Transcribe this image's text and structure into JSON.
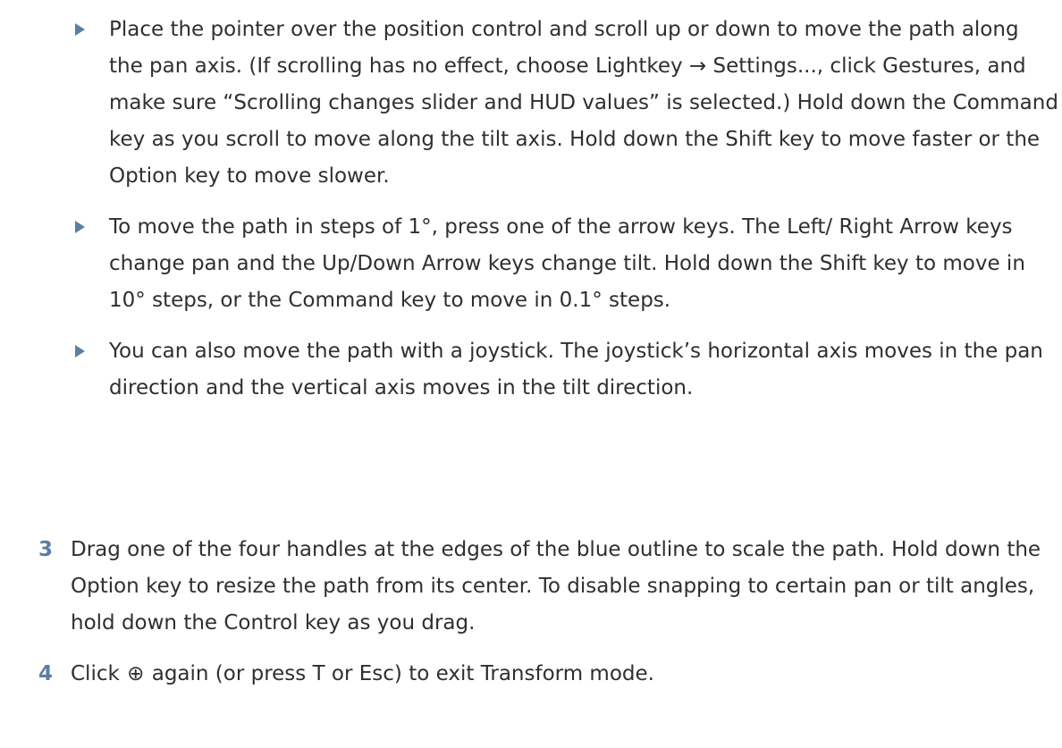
{
  "bullets": [
    {
      "text": "Place the pointer over the position control and scroll up or down to move the path along the pan axis. (If scrolling has no effect, choose Lightkey → Settings..., click Gestures, and make sure “Scrolling changes slider and HUD values” is selected.) Hold down the Command key as you scroll to move along the tilt axis. Hold down the Shift key to move faster or the Option key to move slower."
    },
    {
      "text": "To move the path in steps of 1°, press one of the arrow keys. The Left/ Right Arrow keys change pan and the Up/Down Arrow keys change tilt. Hold down the Shift key to move in 10° steps, or the Command key to move in 0.1° steps."
    },
    {
      "text": "You can also move the path with a joystick. The joystick’s horizontal axis moves in the pan direction and the vertical axis moves in the tilt direction."
    }
  ],
  "steps": [
    {
      "number": "3",
      "text": "Drag one of the four handles at the edges of the blue outline to scale the path. Hold down the Option key to resize the path from its center. To disable snapping to certain pan or tilt angles, hold down the Control key as you drag."
    },
    {
      "number": "4",
      "text_before": "Click",
      "icon": "transform-icon",
      "icon_glyph": "⊕",
      "text_after": "again (or press T or Esc) to exit Transform mode."
    }
  ],
  "colors": {
    "accent": "#5a7fa3",
    "text": "#2f2f2f"
  }
}
